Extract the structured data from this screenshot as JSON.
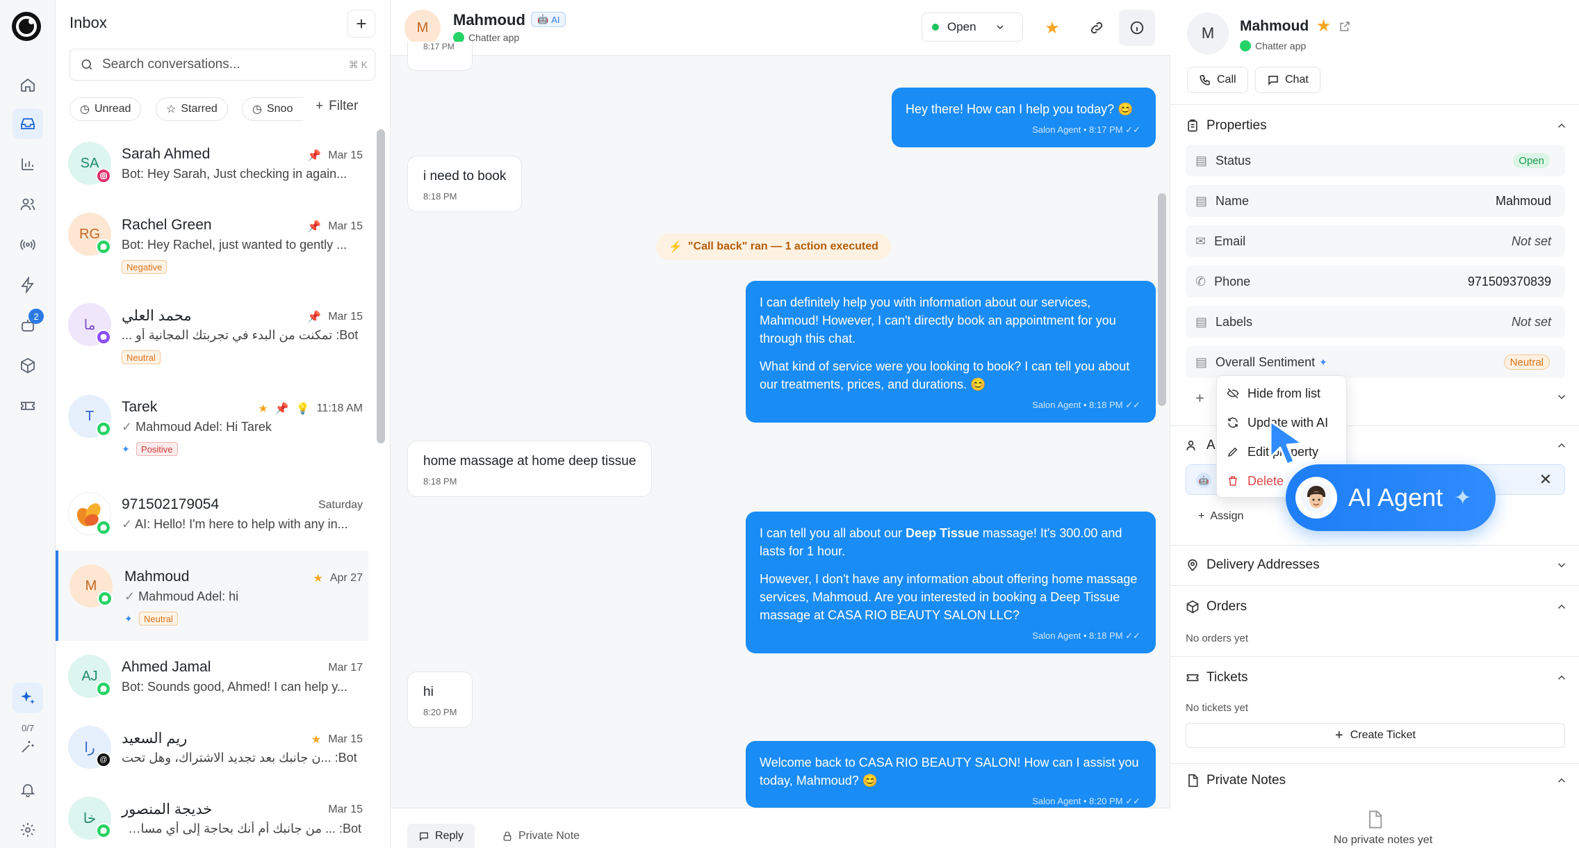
{
  "rail": {
    "items": [
      "home-icon",
      "inbox-icon",
      "analytics-icon",
      "contacts-icon",
      "broadcast-icon",
      "automation-icon",
      "bot-icon",
      "products-icon",
      "tickets-icon"
    ],
    "bot_badge": "2",
    "ai_usage": "0/7"
  },
  "inbox": {
    "title": "Inbox",
    "search_placeholder": "Search conversations...",
    "search_shortcut": "⌘ K",
    "filters": [
      "Unread",
      "Starred",
      "Snoo"
    ],
    "filter_link": "Filter",
    "conversations": [
      {
        "initials": "SA",
        "name": "Sarah Ahmed",
        "date": "Mar 15",
        "msg": "Bot: Hey Sarah, Just checking in again...",
        "tag": "",
        "channel": "instagram"
      },
      {
        "initials": "RG",
        "name": "Rachel Green",
        "date": "Mar 15",
        "msg": "Bot: Hey Rachel, just wanted to gently ...",
        "tag": "Negative",
        "channel": "whatsapp"
      },
      {
        "initials": "ما",
        "name": "محمد العلي",
        "date": "Mar 15",
        "msg": "Bot: تمكنت من البدء في تجربتك المجانية أو ...",
        "tag": "Neutral",
        "channel": "messenger"
      },
      {
        "initials": "T",
        "name": "Tarek",
        "date": "11:18 AM",
        "msg": "Mahmoud Adel: Hi Tarek",
        "tag": "Positive",
        "channel": "whatsapp"
      },
      {
        "initials": "",
        "name": "971502179054",
        "date": "Saturday",
        "msg": "AI: Hello! I'm here to help with any in...",
        "tag": "",
        "channel": "whatsapp"
      },
      {
        "initials": "M",
        "name": "Mahmoud",
        "date": "Apr 27",
        "msg": "Mahmoud Adel: hi",
        "tag": "Neutral",
        "channel": "whatsapp"
      },
      {
        "initials": "AJ",
        "name": "Ahmed Jamal",
        "date": "Mar 17",
        "msg": "Bot: Sounds good, Ahmed! I can help y...",
        "tag": "",
        "channel": "whatsapp"
      },
      {
        "initials": "را",
        "name": "ريم السعيد",
        "date": "Mar 15",
        "msg": "Bot: ...ن جانبك بعد تجديد الاشتراك، وهل تحت",
        "tag": "",
        "channel": "threads"
      },
      {
        "initials": "خا",
        "name": "خديجة المنصور",
        "date": "Mar 15",
        "msg": "Bot: ... من جانبك أم أنك بحاجة إلى أي مساعدة",
        "tag": "",
        "channel": "whatsapp"
      }
    ]
  },
  "chat": {
    "contact_initial": "M",
    "contact_name": "Mahmoud",
    "ai_tag": "AI",
    "channel": "Chatter app",
    "status": "Open",
    "top_partial_time": "8:17 PM",
    "messages": [
      {
        "dir": "out",
        "text": "Hey there! How can I help you today? 😊",
        "meta": "Salon Agent • 8:17 PM"
      },
      {
        "dir": "in",
        "text": "i need to book",
        "time": "8:18 PM"
      },
      {
        "dir": "system",
        "text": "\"Call back\" ran — 1 action executed"
      },
      {
        "dir": "out",
        "p1": "I can definitely help you with information about our services, Mahmoud! However, I can't directly book an appointment for you through this chat.",
        "p2": "What kind of service were you looking to book? I can tell you about our treatments, prices, and durations. 😊",
        "meta": "Salon Agent • 8:18 PM"
      },
      {
        "dir": "in",
        "text": "home massage at home deep tissue",
        "time": "8:18 PM"
      },
      {
        "dir": "out",
        "a": "I can tell you all about our ",
        "bold": "Deep Tissue",
        "b": " massage! It's 300.00 and lasts for 1 hour.",
        "p2": "However, I don't have any information about offering home massage services, Mahmoud. Are you interested in booking a Deep Tissue massage at CASA RIO BEAUTY SALON LLC?",
        "meta": "Salon Agent • 8:18 PM"
      },
      {
        "dir": "in",
        "text": "hi",
        "time": "8:20 PM"
      },
      {
        "dir": "out",
        "text": "Welcome back to CASA RIO BEAUTY SALON! How can I assist you today, Mahmoud? 😊",
        "meta": "Salon Agent • 8:20 PM"
      }
    ],
    "reply_tab": "Reply",
    "note_tab": "Private Note"
  },
  "panel": {
    "initial": "M",
    "name": "Mahmoud",
    "channel": "Chatter app",
    "call": "Call",
    "chat": "Chat",
    "properties_title": "Properties",
    "properties": [
      {
        "label": "Status",
        "value": "Open",
        "kind": "pill-open"
      },
      {
        "label": "Name",
        "value": "Mahmoud",
        "kind": "text"
      },
      {
        "label": "Email",
        "value": "Not set",
        "kind": "italic"
      },
      {
        "label": "Phone",
        "value": "971509370839",
        "kind": "text"
      },
      {
        "label": "Labels",
        "value": "Not set",
        "kind": "italic"
      },
      {
        "label": "Overall Sentiment",
        "value": "Neutral",
        "kind": "pill-neutral"
      }
    ],
    "assignees_initial": "A",
    "assign": "Assign",
    "delivery": "Delivery Addresses",
    "orders": "Orders",
    "no_orders": "No orders yet",
    "tickets": "Tickets",
    "no_tickets": "No tickets yet",
    "create_ticket": "Create Ticket",
    "notes": "Private Notes",
    "no_notes": "No private notes yet"
  },
  "menu": {
    "hide": "Hide from list",
    "update": "Update with AI",
    "edit": "Edit property",
    "delete": "Delete"
  },
  "agent_pill": {
    "label": "AI Agent"
  },
  "colors": {
    "accent": "#1a8cf5",
    "open": "#1c9b4e",
    "neutral": "#d9731a",
    "star": "#f5a623"
  }
}
